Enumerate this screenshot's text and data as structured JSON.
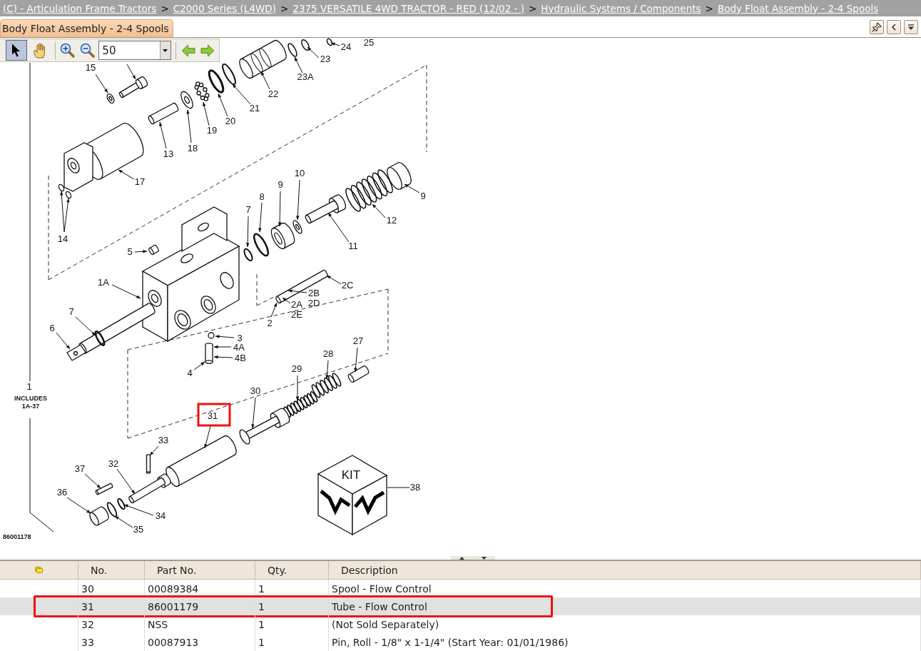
{
  "breadcrumb": [
    {
      "kind": "link",
      "text": "(C) - Articulation Frame Tractors"
    },
    {
      "kind": "separator",
      "text": ">"
    },
    {
      "kind": "link",
      "text": "C2000 Series (L4WD)"
    },
    {
      "kind": "separator",
      "text": ">"
    },
    {
      "kind": "link",
      "text": "2375 VERSATILE 4WD TRACTOR - RED (12/02 - )"
    },
    {
      "kind": "separator",
      "text": ">"
    },
    {
      "kind": "link",
      "text": "Hydraulic Systems / Components"
    },
    {
      "kind": "separator",
      "text": ">"
    },
    {
      "kind": "link",
      "text": "Body Float Assembly - 2-4 Spools"
    }
  ],
  "tabs": [
    {
      "label": "Body Float Assembly - 2-4 Spools",
      "selected": true
    }
  ],
  "toolbar": {
    "tools": [
      {
        "kind": "pointer",
        "selected": true
      },
      {
        "kind": "hand",
        "selected": false
      }
    ],
    "zoom": {
      "value": "50"
    }
  },
  "diagram": {
    "callouts": [
      {
        "label": "25",
        "selected": false
      },
      {
        "label": "24",
        "selected": false
      },
      {
        "label": "23",
        "selected": false
      },
      {
        "label": "23A",
        "selected": false
      },
      {
        "label": "22",
        "selected": false
      },
      {
        "label": "21",
        "selected": false
      },
      {
        "label": "20",
        "selected": false
      },
      {
        "label": "19",
        "selected": false
      },
      {
        "label": "18",
        "selected": false
      },
      {
        "label": "15",
        "selected": false
      },
      {
        "label": "13",
        "selected": false
      },
      {
        "label": "17",
        "selected": false
      },
      {
        "label": "14",
        "selected": false
      },
      {
        "label": "10",
        "selected": false
      },
      {
        "label": "9",
        "selected": false
      },
      {
        "label": "8",
        "selected": false
      },
      {
        "label": "7",
        "selected": false
      },
      {
        "label": "12",
        "selected": false
      },
      {
        "label": "9",
        "selected": false
      },
      {
        "label": "11",
        "selected": false
      },
      {
        "label": "5",
        "selected": false
      },
      {
        "label": "1A",
        "selected": false
      },
      {
        "label": "2C",
        "selected": false
      },
      {
        "label": "2B",
        "selected": false
      },
      {
        "label": "2D",
        "selected": false
      },
      {
        "label": "2A",
        "selected": false
      },
      {
        "label": "2E",
        "selected": false
      },
      {
        "label": "2",
        "selected": false
      },
      {
        "label": "7",
        "selected": false
      },
      {
        "label": "6",
        "selected": false
      },
      {
        "label": "3",
        "selected": false
      },
      {
        "label": "4A",
        "selected": false
      },
      {
        "label": "4B",
        "selected": false
      },
      {
        "label": "4",
        "selected": false
      },
      {
        "label": "27",
        "selected": false
      },
      {
        "label": "28",
        "selected": false
      },
      {
        "label": "29",
        "selected": false
      },
      {
        "label": "30",
        "selected": false
      },
      {
        "label": "31",
        "selected": true
      },
      {
        "label": "33",
        "selected": false
      },
      {
        "label": "32",
        "selected": false
      },
      {
        "label": "37",
        "selected": false
      },
      {
        "label": "36",
        "selected": false
      },
      {
        "label": "34",
        "selected": false
      },
      {
        "label": "35",
        "selected": false
      },
      {
        "label": "38",
        "selected": false
      },
      {
        "label": "1",
        "selected": false
      }
    ],
    "note": [
      "INCLUDES",
      "1A-37"
    ],
    "drawing_number": "86001178",
    "kit_label": "KIT"
  },
  "parts_table": {
    "columns": [
      "No.",
      "Part No.",
      "Qty.",
      "Description"
    ],
    "rows": [
      {
        "cells": [
          "30",
          "00089384",
          "1",
          "Spool - Flow Control"
        ],
        "selected": false
      },
      {
        "cells": [
          "31",
          "86001179",
          "1",
          "Tube - Flow Control"
        ],
        "selected": true
      },
      {
        "cells": [
          "32",
          "NSS",
          "1",
          "(Not Sold Separately)"
        ],
        "selected": false
      },
      {
        "cells": [
          "33",
          "00087913",
          "1",
          "Pin, Roll - 1/8\" x 1-1/4\" (Start Year: 01/01/1986)"
        ],
        "selected": false
      }
    ]
  }
}
